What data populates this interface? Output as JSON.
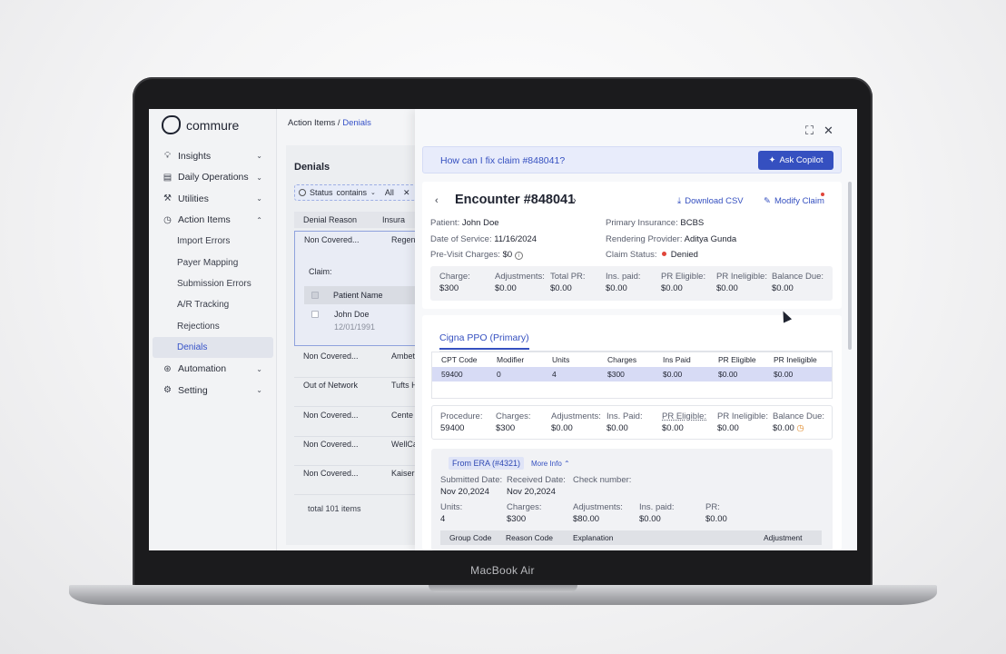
{
  "device": {
    "brand": "MacBook Air"
  },
  "app": {
    "logo_text": "commure"
  },
  "breadcrumb": {
    "parent": "Action Items",
    "separator": " / ",
    "current": "Denials"
  },
  "sidebar": {
    "items": [
      {
        "label": "Insights",
        "icon": "lightbulb-icon"
      },
      {
        "label": "Daily Operations",
        "icon": "calendar-icon"
      },
      {
        "label": "Utilities",
        "icon": "wrench-icon"
      },
      {
        "label": "Action Items",
        "icon": "clock-icon"
      },
      {
        "label": "Automation",
        "icon": "automation-icon"
      },
      {
        "label": "Setting",
        "icon": "gear-icon"
      }
    ],
    "subitems": [
      "Import Errors",
      "Payer Mapping",
      "Submission Errors",
      "A/R Tracking",
      "Rejections",
      "Denials"
    ]
  },
  "list": {
    "title": "Denials",
    "filter": {
      "field": "Status",
      "operator": "contains",
      "value": "All"
    },
    "columns": [
      "Denial Reason",
      "Insura"
    ],
    "expanded": {
      "reason": "Non Covered...",
      "payer": "Regen",
      "claim_label": "Claim:",
      "inner_header": "Patient Name",
      "patient_name": "John Doe",
      "patient_dob": "12/01/1991"
    },
    "rows": [
      {
        "reason": "Non Covered...",
        "payer": "Ambet"
      },
      {
        "reason": "Out of Network",
        "payer": "Tufts H"
      },
      {
        "reason": "Non Covered...",
        "payer": "Cente"
      },
      {
        "reason": "Non Covered...",
        "payer": "WellCa"
      },
      {
        "reason": "Non Covered...",
        "payer": "Kaiser"
      }
    ],
    "total": "total 101 items"
  },
  "drawer": {
    "copilot_question": "How can I fix claim #848041?",
    "copilot_button": "Ask Copilot",
    "encounter_title": "Encounter #848041",
    "download_csv": "Download CSV",
    "modify_claim": "Modify Claim",
    "info": {
      "patient_k": "Patient:",
      "patient_v": "John Doe",
      "dos_k": "Date of Service:",
      "dos_v": "11/16/2024",
      "previsit_k": "Pre-Visit Charges:",
      "previsit_v": "$0",
      "insurance_k": "Primary Insurance:",
      "insurance_v": "BCBS",
      "provider_k": "Rendering Provider:",
      "provider_v": "Aditya Gunda",
      "status_k": "Claim Status:",
      "status_v": "Denied"
    },
    "summary": [
      {
        "k": "Charge:",
        "v": "$300"
      },
      {
        "k": "Adjustments:",
        "v": "$0.00"
      },
      {
        "k": "Total PR:",
        "v": "$0.00"
      },
      {
        "k": "Ins. paid:",
        "v": "$0.00"
      },
      {
        "k": "PR Eligible:",
        "v": "$0.00"
      },
      {
        "k": "PR Ineligible:",
        "v": "$0.00"
      },
      {
        "k": "Balance Due:",
        "v": "$0.00"
      }
    ],
    "tab": "Cigna PPO (Primary)",
    "cpt_columns": [
      "CPT Code",
      "Modifier",
      "Units",
      "Charges",
      "Ins Paid",
      "PR Eligible",
      "PR Ineligible"
    ],
    "cpt_row": [
      "59400",
      "0",
      "4",
      "$300",
      "$0.00",
      "$0.00",
      "$0.00"
    ],
    "procedure": [
      {
        "k": "Procedure:",
        "v": "59400"
      },
      {
        "k": "Charges:",
        "v": "$300"
      },
      {
        "k": "Adjustments:",
        "v": "$0.00"
      },
      {
        "k": "Ins. Paid:",
        "v": "$0.00"
      },
      {
        "k": "PR Eligible:",
        "v": "$0.00"
      },
      {
        "k": "PR Ineligible:",
        "v": "$0.00"
      },
      {
        "k": "Balance Due:",
        "v": "$0.00"
      }
    ],
    "era_badge": "From ERA (#4321)",
    "more_info": "More Info",
    "era_dates": [
      {
        "k": "Submitted Date:",
        "v": "Nov 20,2024"
      },
      {
        "k": "Received Date:",
        "v": "Nov 20,2024"
      },
      {
        "k": "Check number:",
        "v": ""
      }
    ],
    "era_amounts": [
      {
        "k": "Units:",
        "v": "4"
      },
      {
        "k": "Charges:",
        "v": "$300"
      },
      {
        "k": "Adjustments:",
        "v": "$80.00"
      },
      {
        "k": "Ins. paid:",
        "v": "$0.00"
      },
      {
        "k": "PR:",
        "v": "$0.00"
      }
    ],
    "adj_columns": [
      "Group Code",
      "Reason Code",
      "Explanation",
      "Adjustment"
    ]
  },
  "colors": {
    "accent": "#3550c0",
    "status_denied": "#e0453a"
  }
}
